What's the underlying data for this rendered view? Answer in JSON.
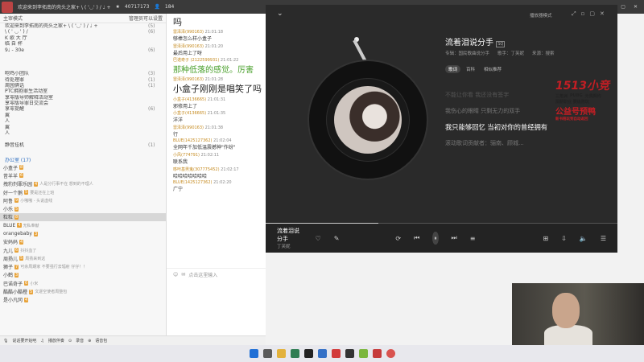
{
  "topbar": {
    "title": "欢迎来到李拓南的壳头之家+ \\ ( '◡' ) / ♩ +",
    "id": "40717173",
    "fans": "184"
  },
  "left": {
    "mode": "主审模式",
    "mgr": "管理员可以设置",
    "channels": [
      {
        "name": "欢迎来到李拓南的壳头之家+ \\ ( '◡' ) / ♩ +",
        "count": "(5)"
      },
      {
        "name": "\\ ( ' ◡ ' ) /",
        "count": "(6)"
      },
      {
        "name": "K 歌 大 厅",
        "count": ""
      },
      {
        "name": "临 自 杯",
        "count": ""
      },
      {
        "name": "9♩ - 30e",
        "count": "(6)"
      },
      {
        "name": "",
        "count": ""
      },
      {
        "name": "",
        "count": ""
      },
      {
        "name": "",
        "count": ""
      },
      {
        "name": "咆鸡小团队",
        "count": "(3)"
      },
      {
        "name": "待处理罪",
        "count": "(1)"
      },
      {
        "name": "周园俩话",
        "count": "(1)"
      },
      {
        "name": "PTC拥抱罪生活动室",
        "count": ""
      },
      {
        "name": "享零版导师解释活动室",
        "count": ""
      },
      {
        "name": "享零版导罪日交流会",
        "count": ""
      },
      {
        "name": "享零提醒",
        "count": "(6)"
      },
      {
        "name": "翼",
        "count": ""
      },
      {
        "name": "人",
        "count": ""
      },
      {
        "name": "翼",
        "count": ""
      },
      {
        "name": "人",
        "count": ""
      },
      {
        "name": "",
        "count": ""
      },
      {
        "name": "静音挂机",
        "count": "(1)"
      },
      {
        "name": "",
        "count": ""
      }
    ],
    "office": "办公室 (17)",
    "users": [
      {
        "name": "小盒子",
        "lv": "8"
      },
      {
        "name": "昔羊羊",
        "lv": "6"
      },
      {
        "name": "拽豹剂罪乐园",
        "lv": "4",
        "note": "人是分行事不在 想到的不理人"
      },
      {
        "name": "好一个鹅",
        "lv": "5",
        "note": "要是还在上班"
      },
      {
        "name": "阿鲁",
        "lv": "9",
        "note": "小嗷嗷 - 头说虚线"
      },
      {
        "name": "小乐",
        "lv": "5"
      },
      {
        "name": "粒粒",
        "lv": "8"
      },
      {
        "name": "BLUE",
        "lv": "4",
        "note": "无私奉献"
      },
      {
        "name": "orangebaby",
        "lv": "3"
      },
      {
        "name": "安妈妈",
        "lv": "4"
      },
      {
        "name": "九儿",
        "lv": "6",
        "note": "抖抖血了"
      },
      {
        "name": "周扬儿",
        "lv": "5",
        "note": "周扬来到这"
      },
      {
        "name": "狮子",
        "lv": "7",
        "note": "可余周期家 不要强行去辐射 仔仔！！"
      },
      {
        "name": "小鹤",
        "lv": "3"
      },
      {
        "name": "巴诺奇子",
        "lv": "6",
        "note": "小米"
      },
      {
        "name": "酷酷小酷橙",
        "lv": "5",
        "note": "文逐空使者周整包"
      },
      {
        "name": "是小凡冈",
        "lv": "4"
      }
    ]
  },
  "chat": {
    "messages": [
      {
        "meta": "",
        "text": "吗",
        "style": "big"
      },
      {
        "nick": "雷泽泽(990163)",
        "time": "21:01:18",
        "text": "够棒怎么样小盒子",
        "style": "sm"
      },
      {
        "nick": "雷泽泽(990163)",
        "time": "21:01:20",
        "text": "最后用上了呀",
        "style": "sm"
      },
      {
        "nick": "巴诺奇子 (2122599931)",
        "time": "21:01:22",
        "text": "那种低落的感觉。厉害",
        "style": "grn"
      },
      {
        "nick": "雷泽泽(990163)",
        "time": "21:01:28",
        "text": "小盒子刚刚是唱笑了吗",
        "style": "big"
      },
      {
        "nick": "小盒子(4136665)",
        "time": "21:01:31",
        "text": "邪修用上了",
        "style": "sm"
      },
      {
        "nick": "小盒子(4136665)",
        "time": "21:01:35",
        "text": "洋洋",
        "style": "sm"
      },
      {
        "nick": "雷泽泽(990163)",
        "time": "21:01:38",
        "text": "行",
        "style": "sm"
      },
      {
        "nick": "BLUE(1425127362)",
        "time": "21:02:04",
        "text": "全网年千加低温震撼神\"作纷\"",
        "style": "sm"
      },
      {
        "nick": "小风(774791)",
        "time": "21:02:11",
        "text": "联系我",
        "style": "sm"
      },
      {
        "nick": "哆咔基男鬼(307775452)",
        "time": "21:02:17",
        "text": "哈哈哈哈哈哈哈",
        "style": "sm"
      },
      {
        "nick": "BLUE(1425127362)",
        "time": "21:02:20",
        "text": "广宁",
        "style": "sm"
      }
    ],
    "input_placeholder": "点击这里输入"
  },
  "bottombar": {
    "voice": "说话要开始吧",
    "music": "播放伴奏",
    "record": "录音",
    "gift": "语音包"
  },
  "player": {
    "mode": "播放器模式",
    "song": "流着泪说分手",
    "tag": "SQ",
    "album": "专辑：国民歌曲说分手",
    "singer": "歌手：丁芙妮",
    "source": "来源：搜索",
    "tabs": [
      "歌词",
      "百科",
      "相似推荐"
    ],
    "lyrics": [
      "不能让你看 我还没有签字",
      "我伤心的眼睛 只剩无力的双手",
      "我只能够回忆 当初对你的曾经拥有",
      "滚动歌词贡献者：骊南、顾城..."
    ],
    "bar_song": "流着泪说分手",
    "bar_singer": "丁芙妮",
    "bar_icons": [
      "like-icon",
      "comment-icon",
      "loop-icon",
      "prev-icon",
      "pause-icon",
      "next-icon",
      "list-icon"
    ]
  },
  "brand": {
    "name": "1513小竞",
    "lines": [
      "三角洲",
      "PUBG",
      "无畏契约"
    ],
    "sub": "深耕职业 赛级陪玩",
    "slogan": "公益号预鸭",
    "small": "新书陪玩到自动返回"
  }
}
